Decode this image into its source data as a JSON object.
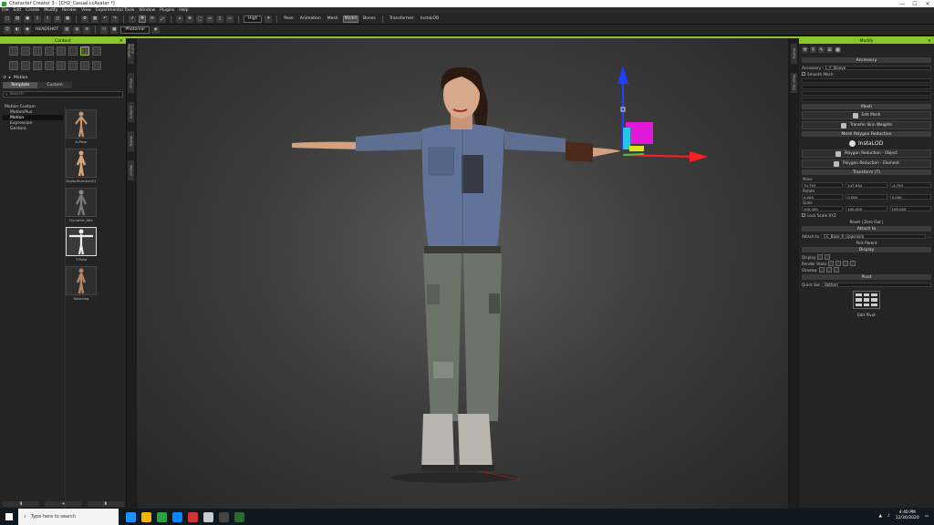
{
  "window": {
    "title": "Character Creator 3 - [CH2_Casual.ccAvatar *]",
    "controls": [
      "—",
      "☐",
      "✕"
    ]
  },
  "menu": [
    "File",
    "Edit",
    "Create",
    "Modify",
    "Render",
    "View",
    "Experimental Tools",
    "Window",
    "Plugins",
    "Help"
  ],
  "toolbar1": {
    "quality": "High",
    "pose_label": "Pose",
    "animation_label": "Animation",
    "mesh_label": "Mesh",
    "model_label": "Model",
    "bones_label": "Bones",
    "transform_label": "Transformer",
    "instalod_label": "InstaLOD"
  },
  "toolbar2": {
    "headshot_label": "HEADSHOT",
    "render_mode": "Photoreal"
  },
  "content_panel": {
    "title": "Content",
    "breadcrumb": "Motion",
    "tabs": [
      "Template",
      "Custom"
    ],
    "active_tab": "Template",
    "search_placeholder": "Search",
    "tree": [
      {
        "label": "Motion Custom",
        "root": true
      },
      {
        "label": "MotionPlus"
      },
      {
        "label": "Motion",
        "selected": true
      },
      {
        "label": "Expression"
      },
      {
        "label": "Gesture"
      }
    ],
    "thumbnails": [
      "A-Pose",
      "DigitalHuman001",
      "Dynamic_Idle",
      "T-Pose",
      "Standing"
    ],
    "footer": [
      "⬇",
      "+",
      "⬍"
    ]
  },
  "left_vtabs": [
    "Scene Manager",
    "Visual",
    "Content",
    "Modify",
    "Motion"
  ],
  "right_vtabs": [
    "Modify",
    "Mesh Ops"
  ],
  "modify_panel": {
    "title": "Modify",
    "accessory_header": "Accessory",
    "accessory_label": "Accessory",
    "accessory_value": "L_F_Sleeve",
    "smooth_label": "Smooth Mesh",
    "mesh_header": "Mesh",
    "edit_mesh": "Edit Mesh",
    "transfer_skin": "Transfer Skin Weights",
    "polygon_header": "Mesh Polygon Reduction",
    "instalod": "InstaLOD",
    "poly_reduce_object": "Polygon Reduction - Object",
    "poly_reduce_element": "Polygon Reduction - Element",
    "transform_header": "Transform (T)",
    "move_label": "Move",
    "move": [
      "70.753",
      "147.934",
      "-4.793"
    ],
    "rotate_label": "Rotate",
    "rotate": [
      "0.000",
      "0.000",
      "0.000"
    ],
    "scale_label": "Scale",
    "scale": [
      "100.000",
      "100.000",
      "100.000"
    ],
    "lock_scale": "Lock Scale XYZ",
    "reset_link": "Reset | Zero Out |",
    "attach_header": "Attach to",
    "attach_label": "Attach to",
    "attach_value": "CC_Base_R_Upperarm",
    "pick_parent": "Pick Parent",
    "display_header": "Display",
    "display_label": "Display",
    "render_label": "Render State",
    "shadow_label": "Shadow",
    "pivot_header": "Pivot",
    "quick_set_label": "Quick Set",
    "quick_set_value": "Bottom",
    "edit_pivot": "Edit Pivot"
  },
  "taskbar": {
    "search_placeholder": "Type here to search",
    "time": "4:40 PM",
    "date": "12/30/2020",
    "app_colors": [
      "#1e90ff",
      "#f4b400",
      "#2ea043",
      "#0a84ff",
      "#d13438",
      "#cccccc",
      "#444444",
      "#2d6a2d"
    ]
  },
  "colors": {
    "accent": "#8ac52a"
  }
}
